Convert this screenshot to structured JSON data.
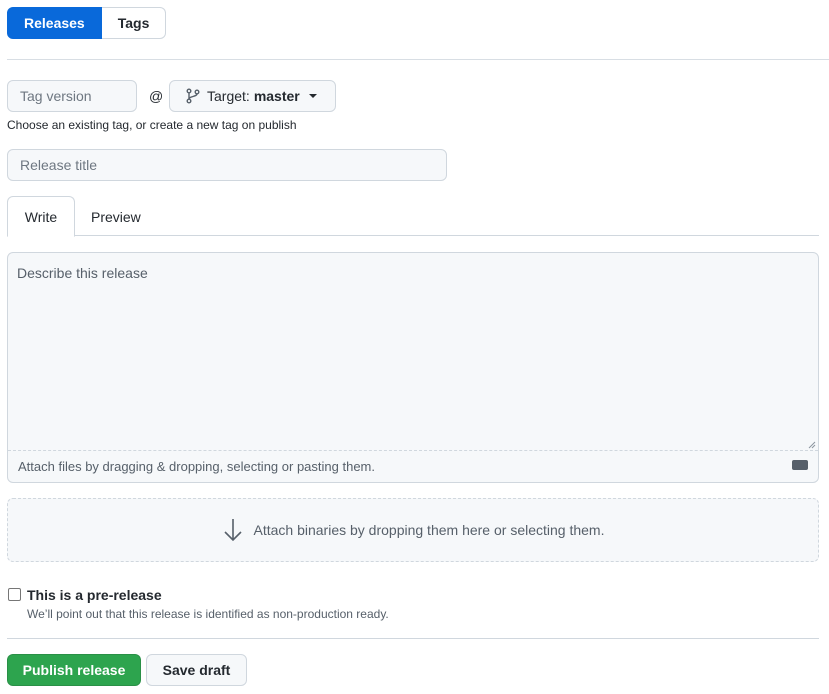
{
  "nav": {
    "releases_label": "Releases",
    "tags_label": "Tags"
  },
  "tag": {
    "placeholder": "Tag version",
    "at_sign": "@",
    "target_label": "Target:",
    "target_value": "master",
    "hint": "Choose an existing tag, or create a new tag on publish"
  },
  "release_title": {
    "placeholder": "Release title"
  },
  "editor": {
    "tabs": [
      "Write",
      "Preview"
    ],
    "active_tab": "Write",
    "placeholder": "Describe this release",
    "attach_hint": "Attach files by dragging & dropping, selecting or pasting them.",
    "markdown_icon": "markdown-icon"
  },
  "binaries": {
    "text": "Attach binaries by dropping them here or selecting them.",
    "icon": "arrow-down-icon"
  },
  "prerelease": {
    "label": "This is a pre-release",
    "description": "We’ll point out that this release is identified as non-production ready.",
    "checked": false
  },
  "actions": {
    "publish_label": "Publish release",
    "draft_label": "Save draft"
  },
  "colors": {
    "accent_blue": "#0969da",
    "publish_green": "#2da44e"
  }
}
